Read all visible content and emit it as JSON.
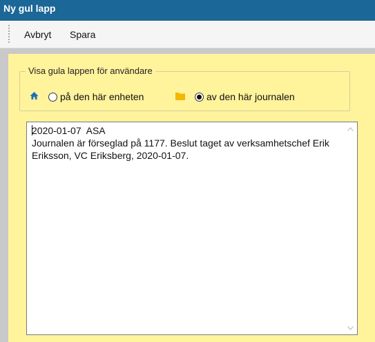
{
  "window": {
    "title": "Ny gul lapp"
  },
  "menu": {
    "cancel_label": "Avbryt",
    "save_label": "Spara"
  },
  "visibility": {
    "legend": "Visa gula lappen för användare",
    "options": [
      {
        "icon": "home-icon",
        "label": "på den här enheten",
        "selected": false
      },
      {
        "icon": "folder-icon",
        "label": "av den här journalen",
        "selected": true
      }
    ]
  },
  "note": {
    "text": "2020-01-07  ASA\nJournalen är förseglad på 1177. Beslut taget av verksamhetschef Erik Eriksson, VC Eriksberg, 2020-01-07."
  },
  "colors": {
    "titlebar": "#1b6797",
    "note_background": "#fff39c",
    "home_icon": "#1e6fb8",
    "folder_icon": "#f2b705"
  }
}
